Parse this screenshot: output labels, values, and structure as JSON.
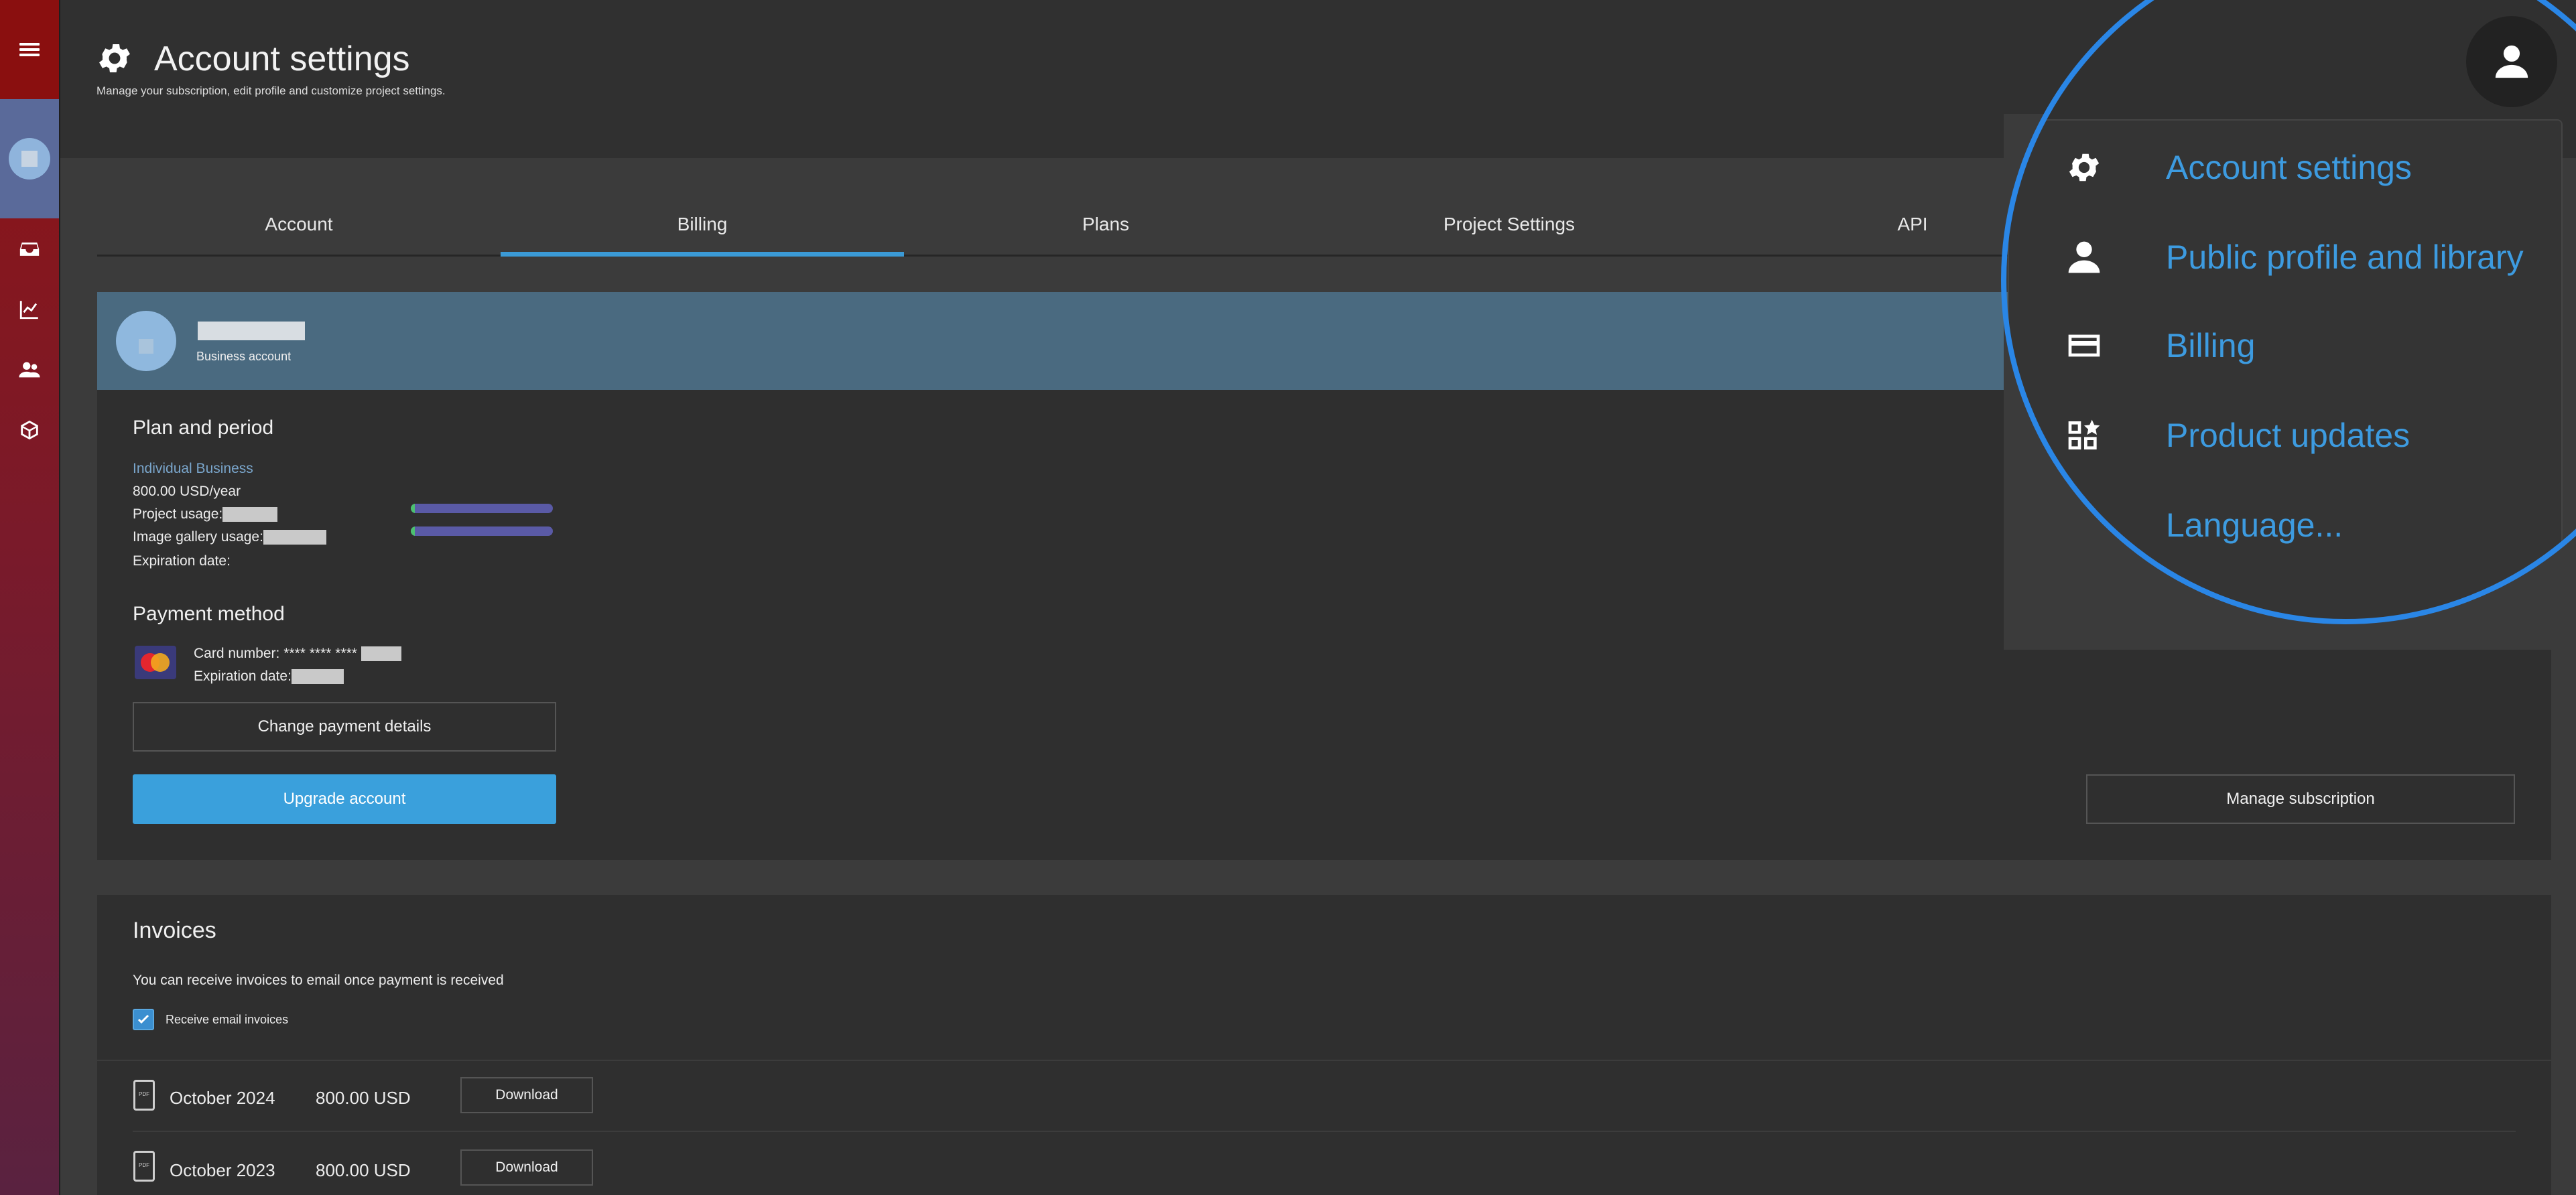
{
  "header": {
    "title": "Account settings",
    "subtitle": "Manage your subscription, edit profile and customize project settings."
  },
  "tabs": [
    "Account",
    "Billing",
    "Plans",
    "Project Settings",
    "API"
  ],
  "active_tab": "Billing",
  "account": {
    "type": "Business account"
  },
  "plan": {
    "section_title": "Plan and period",
    "name": "Individual Business",
    "price": "800.00 USD/year",
    "project_usage_label": "Project usage:",
    "gallery_usage_label": "Image gallery usage:",
    "expiration_label": "Expiration date:"
  },
  "payment": {
    "section_title": "Payment method",
    "card_number_label": "Card number: **** **** ****",
    "expiration_label": "Expiration date:",
    "change_button": "Change payment details",
    "upgrade_button": "Upgrade account",
    "manage_button": "Manage subscription"
  },
  "invoices": {
    "title": "Invoices",
    "description": "You can receive invoices to email once payment is received",
    "checkbox_label": "Receive email invoices",
    "checkbox_checked": true,
    "pdf_label": "PDF",
    "download_label": "Download",
    "rows": [
      {
        "date": "October 2024",
        "amount": "800.00 USD"
      },
      {
        "date": "October 2023",
        "amount": "800.00 USD"
      }
    ]
  },
  "user_menu": {
    "items": [
      {
        "label": "Account settings",
        "icon": "gear-icon"
      },
      {
        "label": "Public profile and library",
        "icon": "person-icon"
      },
      {
        "label": "Billing",
        "icon": "credit-card-icon"
      },
      {
        "label": "Product updates",
        "icon": "widgets-star-icon"
      },
      {
        "label": "Language...",
        "icon": "globe-icon"
      }
    ]
  },
  "colors": {
    "accent": "#3d9be0",
    "sidebar_top": "#8e1414",
    "primary_button": "#3aa0dc",
    "card_header": "#4a6a80"
  }
}
